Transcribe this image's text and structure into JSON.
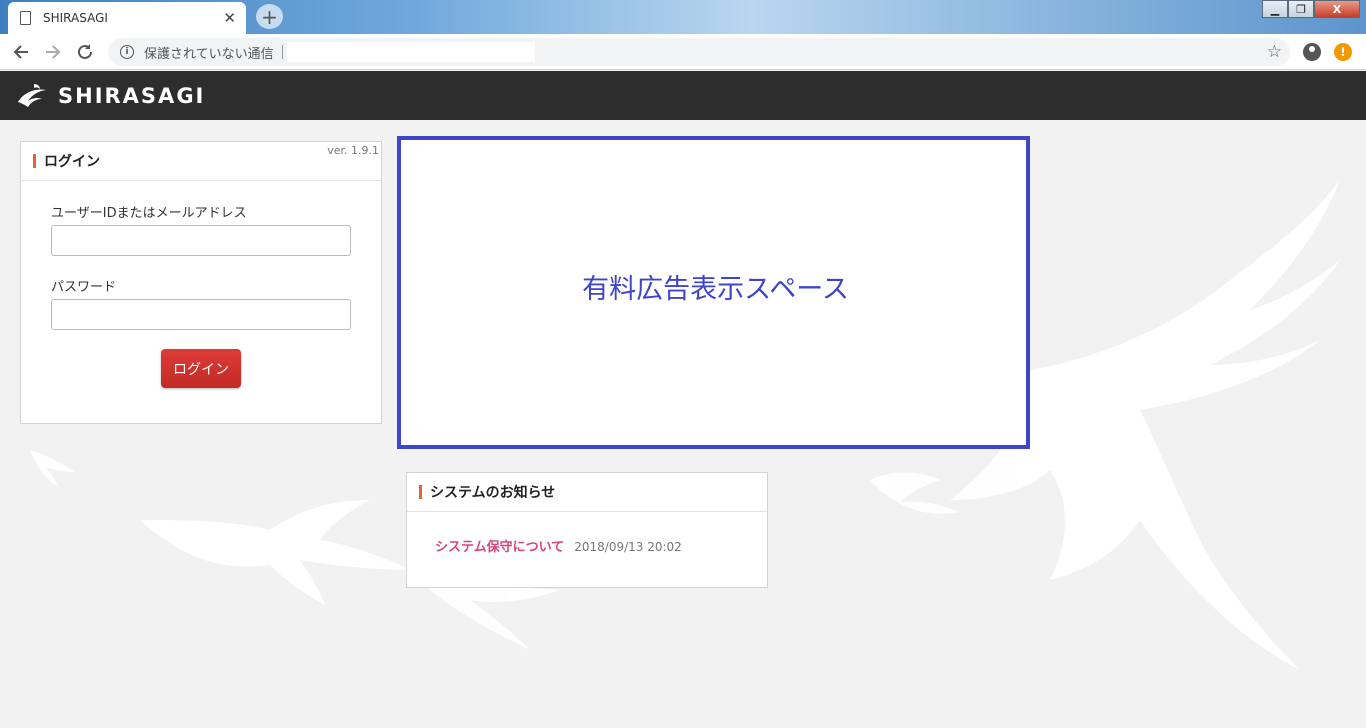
{
  "browser": {
    "tab_title": "SHIRASAGI",
    "tab_close": "✕",
    "new_tab": "+",
    "security_label": "保護されていない通信",
    "win_minimize": "▁",
    "win_restore": "❐",
    "win_close": "X"
  },
  "header": {
    "logo_text": "SHIRASAGI"
  },
  "login": {
    "title": "ログイン",
    "version": "ver. 1.9.1",
    "userid_label": "ユーザーIDまたはメールアドレス",
    "userid_value": "",
    "password_label": "パスワード",
    "password_value": "",
    "submit_label": "ログイン"
  },
  "ad": {
    "text": "有料広告表示スペース"
  },
  "notice": {
    "title": "システムのお知らせ",
    "items": [
      {
        "title": "システム保守について",
        "date": "2018/09/13 20:02"
      }
    ]
  },
  "colors": {
    "accent": "#e0663a",
    "ad_border": "#3f44c9",
    "login_button": "#c22a26",
    "notice_link": "#d6477f",
    "header_bg": "#2d2d2d"
  }
}
